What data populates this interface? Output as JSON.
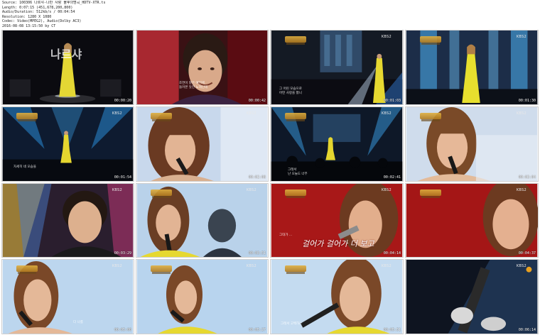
{
  "header": {
    "source": "Source: 100306 나르샤-나만 사랑 불후의명곡_HDTV-XTR.ts",
    "length": "Length: 0:07:15 (451,678,200,800)",
    "audio": "Audio/Duration: 512kb/s / 00:04:54",
    "resolution": "Resolution: 1280 X 1080",
    "video": "Codec: Video(MPEG2), Audio(Dolby AC3)",
    "date": "2016-08-08 13:15:50   by CT"
  },
  "thumbs": [
    {
      "time": "00:00:20",
      "bug": "",
      "title": "나르샤",
      "subtitle_lines": []
    },
    {
      "time": "00:00:42",
      "bug": "",
      "title": "",
      "subtitle_lines": [
        "조연이 맡은 예전에",
        "들어본 듯한 노래인데"
      ]
    },
    {
      "time": "00:01:03",
      "bug": "KBS2",
      "title": "",
      "subtitle_lines": [
        "그 어린 모습으로",
        "어떤 사랑을 쳤니"
      ]
    },
    {
      "time": "00:01:30",
      "bug": "KBS2",
      "title": "",
      "subtitle_lines": []
    },
    {
      "time": "00:01:54",
      "bug": "KBS2",
      "title": "",
      "subtitle_lines": [
        "자세히 네 모습을"
      ]
    },
    {
      "time": "00:02:08",
      "bug": "KBS2",
      "title": "",
      "subtitle_lines": []
    },
    {
      "time": "00:02:41",
      "bug": "KBS2",
      "title": "",
      "subtitle_lines": [
        "그래서",
        "난 오늘도 너무"
      ]
    },
    {
      "time": "00:03:04",
      "bug": "KBS2",
      "title": "",
      "subtitle_lines": []
    },
    {
      "time": "00:03:29",
      "bug": "KBS2",
      "title": "",
      "subtitle_lines": []
    },
    {
      "time": "00:03:51",
      "bug": "KBS2",
      "title": "",
      "subtitle_lines": []
    },
    {
      "time": "00:04:14",
      "bug": "KBS2",
      "title": "",
      "subtitle_lines": [
        "그대가 ..."
      ],
      "lyric": "걸어가 걸어가 더 보고"
    },
    {
      "time": "00:04:37",
      "bug": "KBS2",
      "title": "",
      "subtitle_lines": []
    },
    {
      "time": "00:05:00",
      "bug": "KBS2",
      "title": "",
      "subtitle_lines": [
        "다 나를"
      ]
    },
    {
      "time": "00:05:27",
      "bug": "KBS2",
      "title": "",
      "subtitle_lines": []
    },
    {
      "time": "00:05:51",
      "bug": "KBS2",
      "title": "",
      "subtitle_lines": [
        "그래서 고백하는"
      ]
    },
    {
      "time": "00:06:14",
      "bug": "KBS2",
      "title": "",
      "subtitle_lines": []
    }
  ],
  "colors": {
    "stage_dark": "#101018",
    "stage_blue": "#2a5fa0",
    "dress_yellow": "#e6d830",
    "red_scene": "#a81818"
  }
}
